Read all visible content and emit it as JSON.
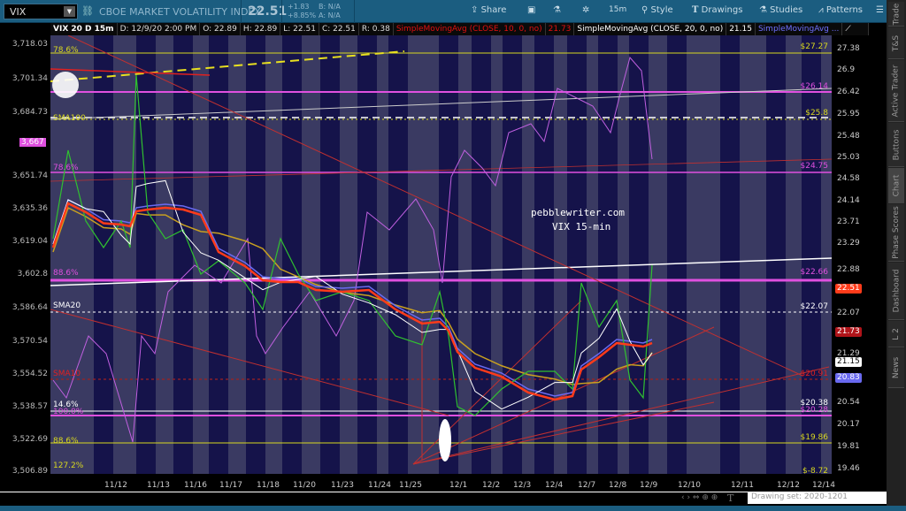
{
  "header": {
    "symbol": "VIX",
    "title": "CBOE MARKET VOLATILITY INDEX",
    "last": "22.51",
    "change": "+1.83",
    "change_pct": "+8.85%",
    "bid": "B: N/A",
    "ask": "A: N/A",
    "toolbar": {
      "share": "Share",
      "timeframe": "15m",
      "style": "Style",
      "drawings": "Drawings",
      "studies": "Studies",
      "patterns": "Patterns"
    }
  },
  "info": {
    "symbol_period": "VIX 20 D 15m",
    "date": "D: 12/9/20 2:00 PM",
    "open": "O: 22.89",
    "high": "H: 22.89",
    "low": "L: 22.51",
    "close": "C: 22.51",
    "range": "R: 0.38",
    "sma10_label": "SimpleMovingAvg (CLOSE, 10, 0, no)",
    "sma10_value": "21.73",
    "sma20_label": "SimpleMovingAvg (CLOSE, 20, 0, no)",
    "sma20_value": "21.15",
    "sma_more": "SimpleMovingAvg ..."
  },
  "watermark": {
    "line1": "pebblewriter.com",
    "line2": "VIX 15-min"
  },
  "left_axis": [
    "3,718.03",
    "3,701.34",
    "3,684.73",
    "3,667",
    "3,651.74",
    "3,635.36",
    "3,619.04",
    "3,602.8",
    "3,586.64",
    "3,570.54",
    "3,554.52",
    "3,538.57",
    "3,522.69",
    "3,506.89"
  ],
  "right_axis": [
    "27.38",
    "26.9",
    "26.42",
    "25.95",
    "25.48",
    "25.03",
    "24.58",
    "24.14",
    "23.71",
    "23.29",
    "22.88",
    "22.07",
    "21.29",
    "20.54",
    "20.17",
    "19.81",
    "19.46"
  ],
  "price_tags": [
    {
      "value": "22.51",
      "color": "#ff3b1a"
    },
    {
      "value": "21.73",
      "color": "#b0141a"
    },
    {
      "value": "21.15",
      "color": "#ffffff"
    },
    {
      "value": "20.83",
      "color": "#6a6af0"
    }
  ],
  "levels_left": [
    "78.6%",
    "SMA100",
    "78.6%",
    "88.6%",
    "SMA20",
    "SMA10",
    "14.6%",
    "100.0%",
    "88.6%",
    "127.2%"
  ],
  "levels_right": [
    "$27.27",
    "$26.14",
    "$25.8",
    "$24.75",
    "$22.66",
    "$22.07",
    "$20.91",
    "$20.38",
    "$20.28",
    "$19.86",
    "$-8.72"
  ],
  "dates": [
    "11/12",
    "11/13",
    "11/16",
    "11/17",
    "11/18",
    "11/20",
    "11/23",
    "11/24",
    "11/25",
    "12/1",
    "12/2",
    "12/3",
    "12/4",
    "12/7",
    "12/8",
    "12/9",
    "12/10",
    "12/11",
    "12/12",
    "12/14"
  ],
  "side_tabs": [
    "Trade",
    "T&S",
    "Active Trader",
    "Buttons",
    "Chart",
    "Phase Scores",
    "Dashboard",
    "L 2",
    "News"
  ],
  "drawing_set": "Drawing set: 2020-1201",
  "colors": {
    "toolbar": "#1b5d80",
    "sma10": "#ff3b1a",
    "sma20": "#ffffff",
    "spx": "#c060e0",
    "level_magenta": "#e050e0",
    "level_yellow": "#d8d820"
  }
}
